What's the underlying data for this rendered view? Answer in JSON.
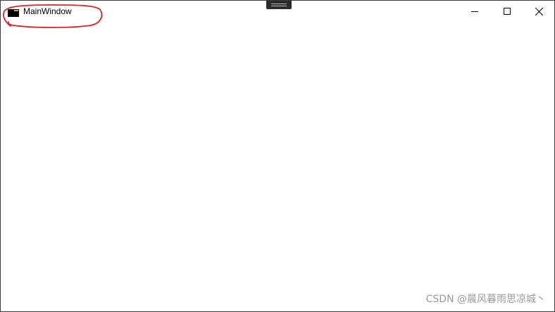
{
  "window": {
    "title": "MainWindow",
    "icon": "window-app-icon"
  },
  "caption_buttons": {
    "minimize_icon": "minimize-icon",
    "maximize_icon": "maximize-icon",
    "close_icon": "close-icon"
  },
  "annotation": {
    "color": "#e02020",
    "shape": "hand-drawn ellipse around title"
  },
  "watermark": {
    "text": "CSDN @晨风暮雨思凉城丶"
  }
}
